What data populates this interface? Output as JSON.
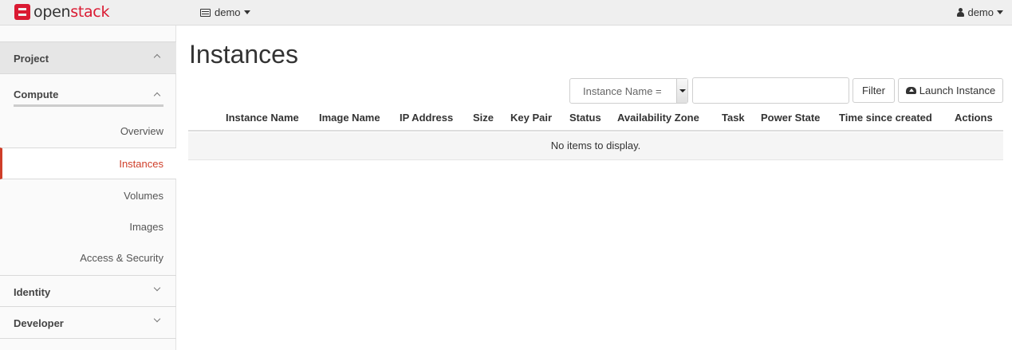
{
  "brand": {
    "name_prefix": "open",
    "name_suffix": "stack"
  },
  "header": {
    "project_label": "demo",
    "user_label": "demo"
  },
  "sidebar": {
    "project_label": "Project",
    "compute_label": "Compute",
    "items": [
      {
        "label": "Overview"
      },
      {
        "label": "Instances",
        "active": true
      },
      {
        "label": "Volumes"
      },
      {
        "label": "Images"
      },
      {
        "label": "Access & Security"
      }
    ],
    "identity_label": "Identity",
    "developer_label": "Developer"
  },
  "main": {
    "title": "Instances",
    "filter_select_value": "Instance Name =",
    "filter_input_value": "",
    "filter_button": "Filter",
    "launch_button": "Launch Instance",
    "columns": [
      "Instance Name",
      "Image Name",
      "IP Address",
      "Size",
      "Key Pair",
      "Status",
      "Availability Zone",
      "Task",
      "Power State",
      "Time since created",
      "Actions"
    ],
    "empty_message": "No items to display."
  },
  "colors": {
    "accent": "#cf3e29",
    "brand_red": "#da1a32",
    "navbar_bg": "#efefef"
  }
}
